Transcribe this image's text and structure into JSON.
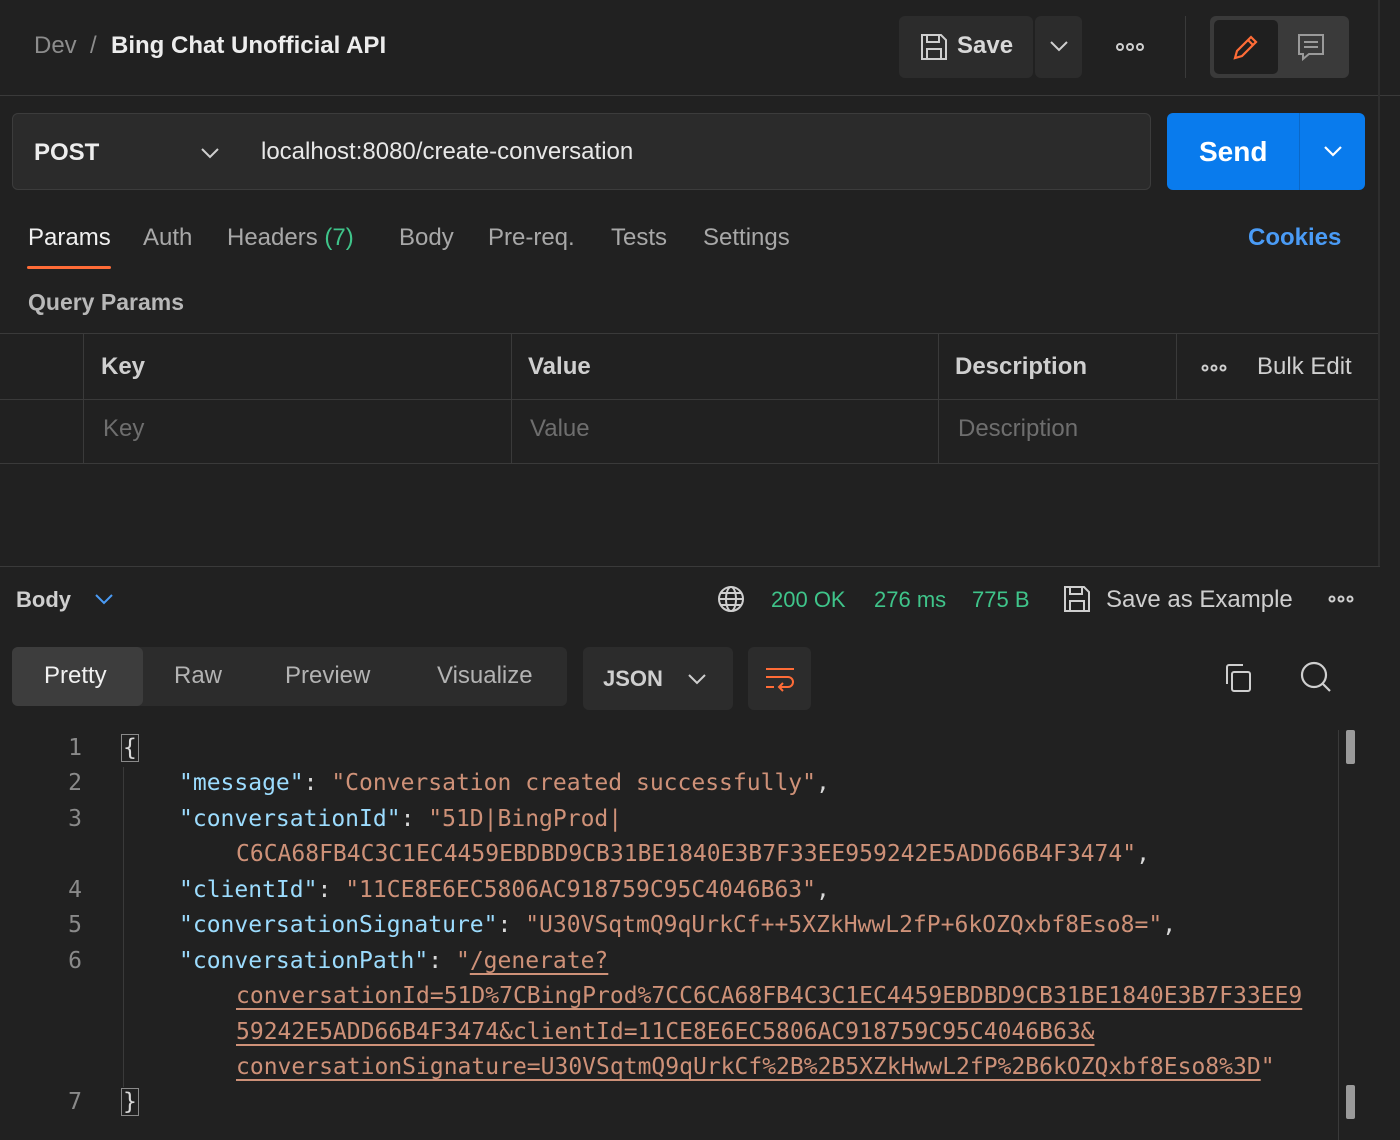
{
  "breadcrumb": {
    "parent": "Dev",
    "separator": "/",
    "title": "Bing Chat Unofficial API"
  },
  "toolbar": {
    "save_label": "Save"
  },
  "request": {
    "method": "POST",
    "url": "localhost:8080/create-conversation",
    "send_label": "Send"
  },
  "tabs": [
    {
      "label": "Params",
      "active": true
    },
    {
      "label": "Auth"
    },
    {
      "label": "Headers",
      "count": "(7)"
    },
    {
      "label": "Body"
    },
    {
      "label": "Pre-req."
    },
    {
      "label": "Tests"
    },
    {
      "label": "Settings"
    }
  ],
  "cookies_label": "Cookies",
  "query_params": {
    "title": "Query Params",
    "columns": [
      "Key",
      "Value",
      "Description"
    ],
    "placeholders": [
      "Key",
      "Value",
      "Description"
    ],
    "bulk_edit_label": "Bulk Edit"
  },
  "response": {
    "body_label": "Body",
    "status": "200 OK",
    "time": "276 ms",
    "size": "775 B",
    "save_example_label": "Save as Example",
    "view_tabs": [
      "Pretty",
      "Raw",
      "Preview",
      "Visualize"
    ],
    "format": "JSON",
    "code": {
      "line_numbers": [
        "1",
        "2",
        "3",
        "4",
        "5",
        "6",
        "7"
      ],
      "open_brace": "{",
      "close_brace": "}",
      "colon": ": ",
      "comma": ",",
      "message_key": "\"message\"",
      "message_val": "\"Conversation created successfully\"",
      "conversationId_key": "\"conversationId\"",
      "conversationId_val_1": "\"51D|BingProd|",
      "conversationId_val_2": "C6CA68FB4C3C1EC4459EBDBD9CB31BE1840E3B7F33EE959242E5ADD66B4F3474\"",
      "clientId_key": "\"clientId\"",
      "clientId_val": "\"11CE8E6EC5806AC918759C95C4046B63\"",
      "conversationSignature_key": "\"conversationSignature\"",
      "conversationSignature_val": "\"U30VSqtmQ9qUrkCf++5XZkHwwL2fP+6kOZQxbf8Eso8=\"",
      "conversationPath_key": "\"conversationPath\"",
      "quote": "\"",
      "conversationPath_val_1": "/generate?",
      "conversationPath_val_2": "conversationId=51D%7CBingProd%7CC6CA68FB4C3C1EC4459EBDBD9CB31BE1840E3B7F33EE9",
      "conversationPath_val_3": "59242E5ADD66B4F3474&clientId=11CE8E6EC5806AC918759C95C4046B63&",
      "conversationPath_val_4": "conversationSignature=U30VSqtmQ9qUrkCf%2B%2B5XZkHwwL2fP%2B6kOZQxbf8Eso8%3D"
    }
  },
  "colors": {
    "background": "#212121",
    "accent_orange": "#ff6c37",
    "send_blue": "#097bed",
    "status_green": "#3fc48a",
    "link_blue": "#4a9bf5",
    "json_key": "#9cdcfe",
    "json_string": "#ce9178"
  },
  "icons": [
    "save-icon",
    "chevron-down-icon",
    "more-horizontal-icon",
    "pencil-icon",
    "comment-icon",
    "globe-icon",
    "copy-icon",
    "search-icon",
    "wrap-lines-icon"
  ]
}
